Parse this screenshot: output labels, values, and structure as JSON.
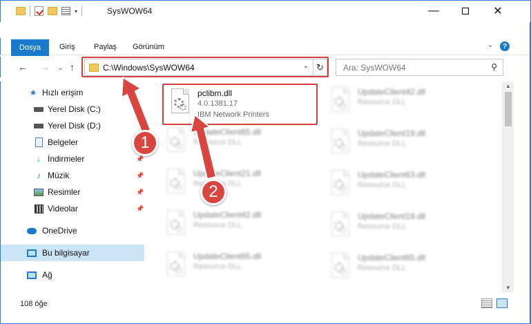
{
  "window": {
    "title": "SysWOW64",
    "minimize_glyph": "—",
    "close_glyph": "✕"
  },
  "ribbon": {
    "tabs": [
      "Dosya",
      "Giriş",
      "Paylaş",
      "Görünüm"
    ],
    "accent": "#1979ca"
  },
  "address": {
    "path": "C:\\Windows\\SysWOW64",
    "search_placeholder": "Ara: SysWOW64"
  },
  "sidebar": {
    "items": [
      {
        "label": "Hızlı erişim",
        "icon": "star-icon"
      },
      {
        "label": "Yerel Disk (C:)",
        "icon": "drive-icon"
      },
      {
        "label": "Yerel Disk (D:)",
        "icon": "drive-icon"
      },
      {
        "label": "Belgeler",
        "icon": "document-icon"
      },
      {
        "label": "İndirmeler",
        "icon": "download-icon"
      },
      {
        "label": "Müzik",
        "icon": "music-icon"
      },
      {
        "label": "Resimler",
        "icon": "pictures-icon"
      },
      {
        "label": "Videolar",
        "icon": "video-icon"
      },
      {
        "label": "OneDrive",
        "icon": "cloud-icon"
      },
      {
        "label": "Bu bilgisayar",
        "icon": "computer-icon"
      },
      {
        "label": "Ağ",
        "icon": "network-icon"
      }
    ]
  },
  "files": {
    "selected": {
      "name": "pclibm.dll",
      "version": "4.0.1381.17",
      "description": "IBM Network Printers"
    },
    "left_column": [
      {
        "name": "UpdateClient65.dll",
        "type": "Resource DLL"
      },
      {
        "name": "UpdateClient21.dll",
        "type": "Resource DLL"
      },
      {
        "name": "UpdateClient42.dll",
        "type": "Resource DLL"
      },
      {
        "name": "UpdateClient65.dll",
        "type": "Resource DLL"
      }
    ],
    "right_column": [
      {
        "name": "UpdateClient42.dll",
        "type": "Resource DLL"
      },
      {
        "name": "UpdateClient19.dll",
        "type": "Resource DLL"
      },
      {
        "name": "UpdateClient63.dll",
        "type": "Resource DLL"
      },
      {
        "name": "UpdateClient19.dll",
        "type": "Resource DLL"
      },
      {
        "name": "UpdateClient65.dll",
        "type": "Resource DLL"
      }
    ]
  },
  "status": {
    "item_count": "108 öğe"
  },
  "annotations": {
    "step1": "1",
    "step2": "2",
    "color": "#d9463f"
  }
}
